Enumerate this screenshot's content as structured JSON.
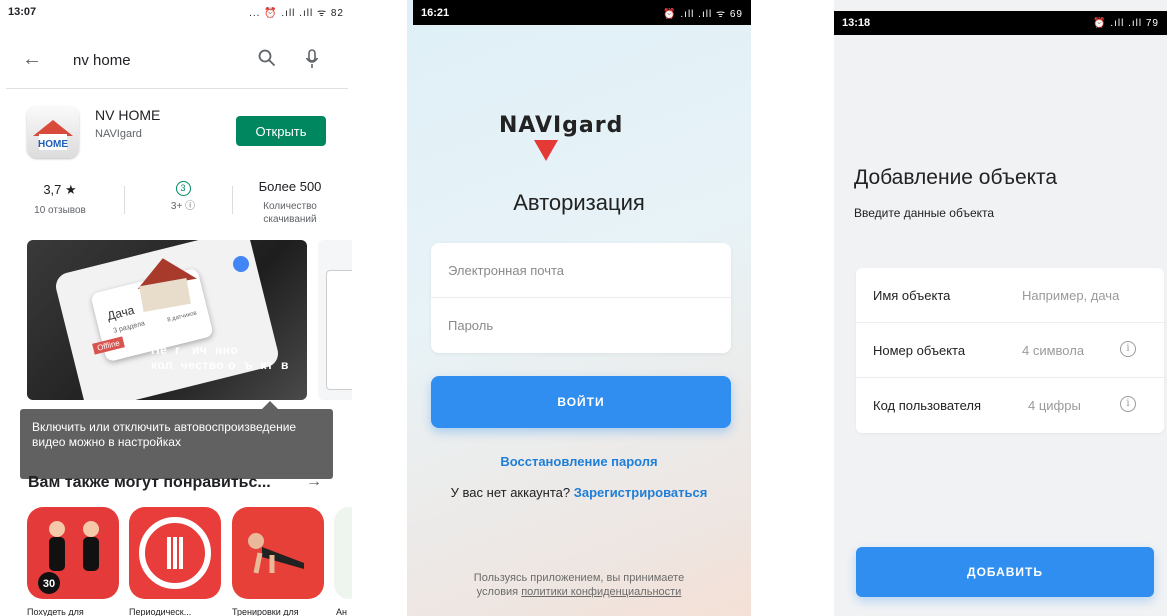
{
  "play_store": {
    "status": {
      "time": "13:07",
      "icons": "... ⏰ .ıll .ıll ᯤ 82"
    },
    "search": {
      "query": "nv home"
    },
    "app": {
      "name": "NV HOME",
      "developer": "NAVIgard",
      "icon_text": "HOME",
      "open_label": "Открыть"
    },
    "stats": {
      "rating": "3,7 ★",
      "reviews": "10 отзывов",
      "age_badge": "3",
      "age": "3+ ⓘ",
      "downloads": "Более 500",
      "downloads_label_1": "Количество",
      "downloads_label_2": "скачиваний"
    },
    "screenshot": {
      "card_title": "Дача",
      "card_sections": "3 раздела",
      "card_sensors": "8 датчиков",
      "offline": "Offline",
      "overlay": "Не  г   ич  нно\nкол  чество о  ъ  кт  в"
    },
    "tooltip": "Включить или отключить автовоспроизведение видео можно в настройках",
    "also_like": "Вам также могут понравитьс...",
    "recs": [
      {
        "label": "Похудеть для"
      },
      {
        "label": "Периодическ..."
      },
      {
        "label": "Тренировки для"
      },
      {
        "label": "Ан"
      }
    ]
  },
  "auth": {
    "status": {
      "time": "16:21",
      "icons": "⏰ .ıll .ıll ᯤ 69"
    },
    "logo": "NAVIgard",
    "title": "Авторизация",
    "email_placeholder": "Электронная почта",
    "password_placeholder": "Пароль",
    "login_label": "ВОЙТИ",
    "recover_label": "Восстановление пароля",
    "no_account": "У вас нет аккаунта?",
    "register_label": "Зарегистрироваться",
    "terms_1": "Пользуясь приложением, вы принимаете",
    "terms_2": "условия",
    "terms_link": "политики конфиденциальности"
  },
  "add_object": {
    "status": {
      "time": "13:18",
      "icons": "⏰ .ıll .ıll 79"
    },
    "title": "Добавление объекта",
    "subtitle": "Введите данные объекта",
    "fields": [
      {
        "label": "Имя объекта",
        "placeholder": "Например, дача"
      },
      {
        "label": "Номер объекта",
        "placeholder": "4 символа"
      },
      {
        "label": "Код пользователя",
        "placeholder": "4 цифры"
      }
    ],
    "add_label": "ДОБАВИТЬ"
  },
  "colors": {
    "play_green": "#01875f",
    "primary_blue": "#2f8ef0",
    "link_blue": "#1f7ed8",
    "logo_red": "#e53935"
  }
}
